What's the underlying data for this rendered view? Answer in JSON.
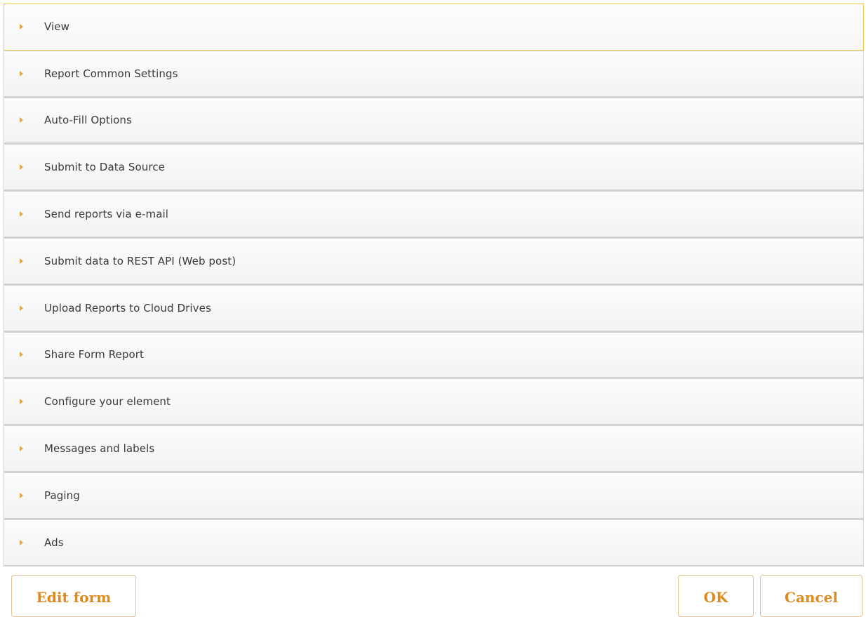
{
  "accordion": {
    "items": [
      {
        "label": "View"
      },
      {
        "label": "Report Common Settings"
      },
      {
        "label": "Auto-Fill Options"
      },
      {
        "label": "Submit to Data Source"
      },
      {
        "label": "Send reports via e-mail"
      },
      {
        "label": "Submit data to REST API (Web post)"
      },
      {
        "label": "Upload Reports to Cloud Drives"
      },
      {
        "label": "Share Form Report"
      },
      {
        "label": "Configure your element"
      },
      {
        "label": "Messages and labels"
      },
      {
        "label": "Paging"
      },
      {
        "label": "Ads"
      }
    ],
    "active_index": 0,
    "arrow_icon": "triangle-right-icon",
    "accent_color": "#e0a64a",
    "active_border_color": "#f2c94c"
  },
  "footer": {
    "edit_label": "Edit form",
    "ok_label": "OK",
    "cancel_label": "Cancel",
    "button_text_color": "#e08a1e"
  }
}
